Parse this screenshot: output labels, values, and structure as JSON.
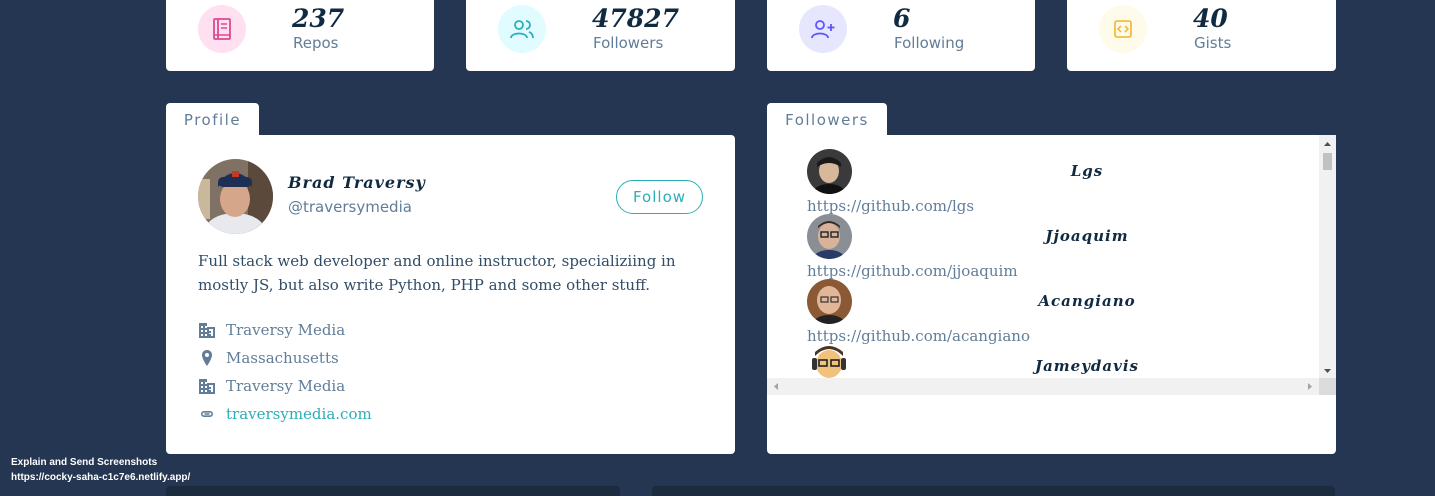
{
  "stats": [
    {
      "count": "237",
      "label": "Repos",
      "icon": "book-icon",
      "color": "#da4a91",
      "bg": "#ffe0f0"
    },
    {
      "count": "47827",
      "label": "Followers",
      "icon": "users-icon",
      "color": "#2caeba",
      "bg": "#e0fcff"
    },
    {
      "count": "6",
      "label": "Following",
      "icon": "user-plus-icon",
      "color": "#5d55fa",
      "bg": "#e6e6ff"
    },
    {
      "count": "40",
      "label": "Gists",
      "icon": "code-icon",
      "color": "#f0b429",
      "bg": "#fffbea"
    }
  ],
  "profile": {
    "tab_label": "Profile",
    "name": "Brad Traversy",
    "handle": "@traversymedia",
    "follow_label": "Follow",
    "bio": "Full stack web developer and online instructor, specializiing in mostly JS, but also write Python, PHP and some other stuff.",
    "company": "Traversy Media",
    "location": "Massachusetts",
    "company2": "Traversy Media",
    "blog": "traversymedia.com"
  },
  "followers": {
    "tab_label": "Followers",
    "items": [
      {
        "login": "Lgs",
        "url": "https://github.com/lgs"
      },
      {
        "login": "Jjoaquim",
        "url": "https://github.com/jjoaquim"
      },
      {
        "login": "Acangiano",
        "url": "https://github.com/acangiano"
      },
      {
        "login": "Jameydavis",
        "url": ""
      }
    ]
  },
  "extension": {
    "title": "Explain and Send Screenshots",
    "url": "https://cocky-saha-c1c7e6.netlify.app/"
  }
}
